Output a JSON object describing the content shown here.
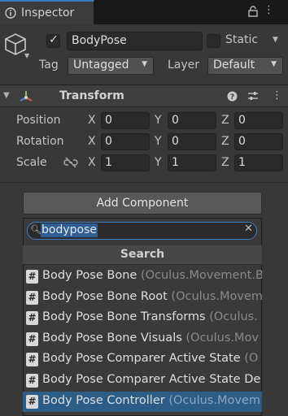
{
  "window": {
    "tab_label": "Inspector",
    "accent_color": "#3a79bb"
  },
  "game_object": {
    "active": true,
    "name": "BodyPose",
    "static_label": "Static",
    "static": false,
    "tag_label": "Tag",
    "tag_value": "Untagged",
    "layer_label": "Layer",
    "layer_value": "Default"
  },
  "transform": {
    "title": "Transform",
    "rows": [
      {
        "label": "Position",
        "x": "0",
        "y": "0",
        "z": "0"
      },
      {
        "label": "Rotation",
        "x": "0",
        "y": "0",
        "z": "0"
      },
      {
        "label": "Scale",
        "x": "1",
        "y": "1",
        "z": "1"
      }
    ],
    "axes": [
      "X",
      "Y",
      "Z"
    ]
  },
  "add_component": {
    "button_label": "Add Component",
    "search_value": "bodypose",
    "search_header": "Search",
    "results": [
      {
        "name": "Body Pose Bone ",
        "namespace": "(Oculus.Movement.B",
        "selected": false
      },
      {
        "name": "Body Pose Bone Root ",
        "namespace": "(Oculus.Movem",
        "selected": false
      },
      {
        "name": "Body Pose Bone Transforms ",
        "namespace": "(Oculus.",
        "selected": false
      },
      {
        "name": "Body Pose Bone Visuals ",
        "namespace": "(Oculus.Mov",
        "selected": false
      },
      {
        "name": "Body Pose Comparer Active State ",
        "namespace": "(O",
        "selected": false
      },
      {
        "name": "Body Pose Comparer Active State De",
        "namespace": "",
        "selected": false
      },
      {
        "name": "Body Pose Controller ",
        "namespace": "(Oculus.Movem",
        "selected": true
      }
    ]
  }
}
